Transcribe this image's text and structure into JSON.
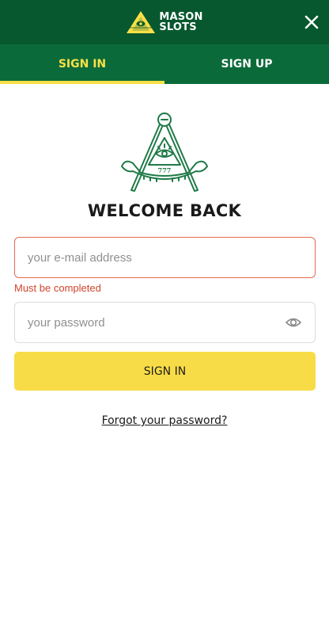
{
  "header": {
    "logo_line1": "MASON",
    "logo_line2": "SLOTS",
    "logo_icon": "eye-pyramid-icon",
    "close_icon": "close-icon"
  },
  "tabs": [
    {
      "label": "SIGN IN",
      "active": true
    },
    {
      "label": "SIGN UP",
      "active": false
    }
  ],
  "emblem": {
    "icon": "compass-square-emblem",
    "number": "777"
  },
  "form": {
    "title": "WELCOME BACK",
    "email_placeholder": "your e-mail address",
    "email_value": "",
    "email_error": "Must be completed",
    "password_placeholder": "your password",
    "password_value": "",
    "password_toggle_icon": "eye-icon",
    "submit_label": "SIGN IN",
    "forgot_label": "Forgot your password?"
  },
  "colors": {
    "header_bg": "#07582f",
    "tabs_bg": "#0b6a3a",
    "accent_yellow": "#f8dc47",
    "emblem_green": "#1e7a47",
    "error": "#d1442b"
  }
}
